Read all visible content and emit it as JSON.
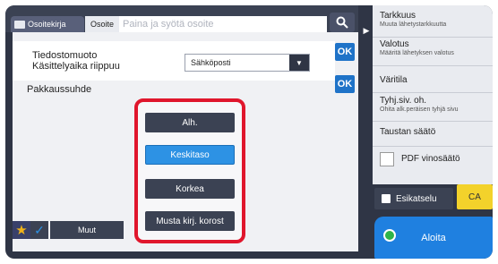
{
  "header": {
    "tab_addressbook": "Osoitekirja",
    "tab_address": "Osoite",
    "address_placeholder": "Paina ja syötä osoite"
  },
  "settings": {
    "filetype_label_line1": "Tiedostomuoto",
    "filetype_label_line2": "Käsittelyaika riippuu",
    "filetype_value": "Sähköposti",
    "ok_label": "OK",
    "compression_title": "Pakkaussuhde",
    "options": [
      "Alh.",
      "Keskitaso",
      "Korkea",
      "Musta kirj. korost"
    ],
    "selected_option": "Keskitaso"
  },
  "bottom": {
    "others_label": "Muut"
  },
  "right_panel": {
    "items": [
      {
        "title": "Tarkkuus",
        "sub": "Muuta lähetystarkkuutta"
      },
      {
        "title": "Valotus",
        "sub": "Määritä lähetyksen valotus"
      },
      {
        "title": "Väritila",
        "sub": ""
      },
      {
        "title": "Tyhj.siv. oh.",
        "sub": "Ohita alk.peräisen tyhjä sivu"
      },
      {
        "title": "Taustan säätö",
        "sub": ""
      }
    ],
    "pdf_label": "PDF vinosäätö"
  },
  "actions": {
    "preview_label": "Esikatselu",
    "ca_label": "CA",
    "start_label": "Aloita"
  },
  "colors": {
    "accent_blue": "#1f80e0",
    "highlight_red": "#e0162c",
    "ca_yellow": "#f3d22b"
  }
}
